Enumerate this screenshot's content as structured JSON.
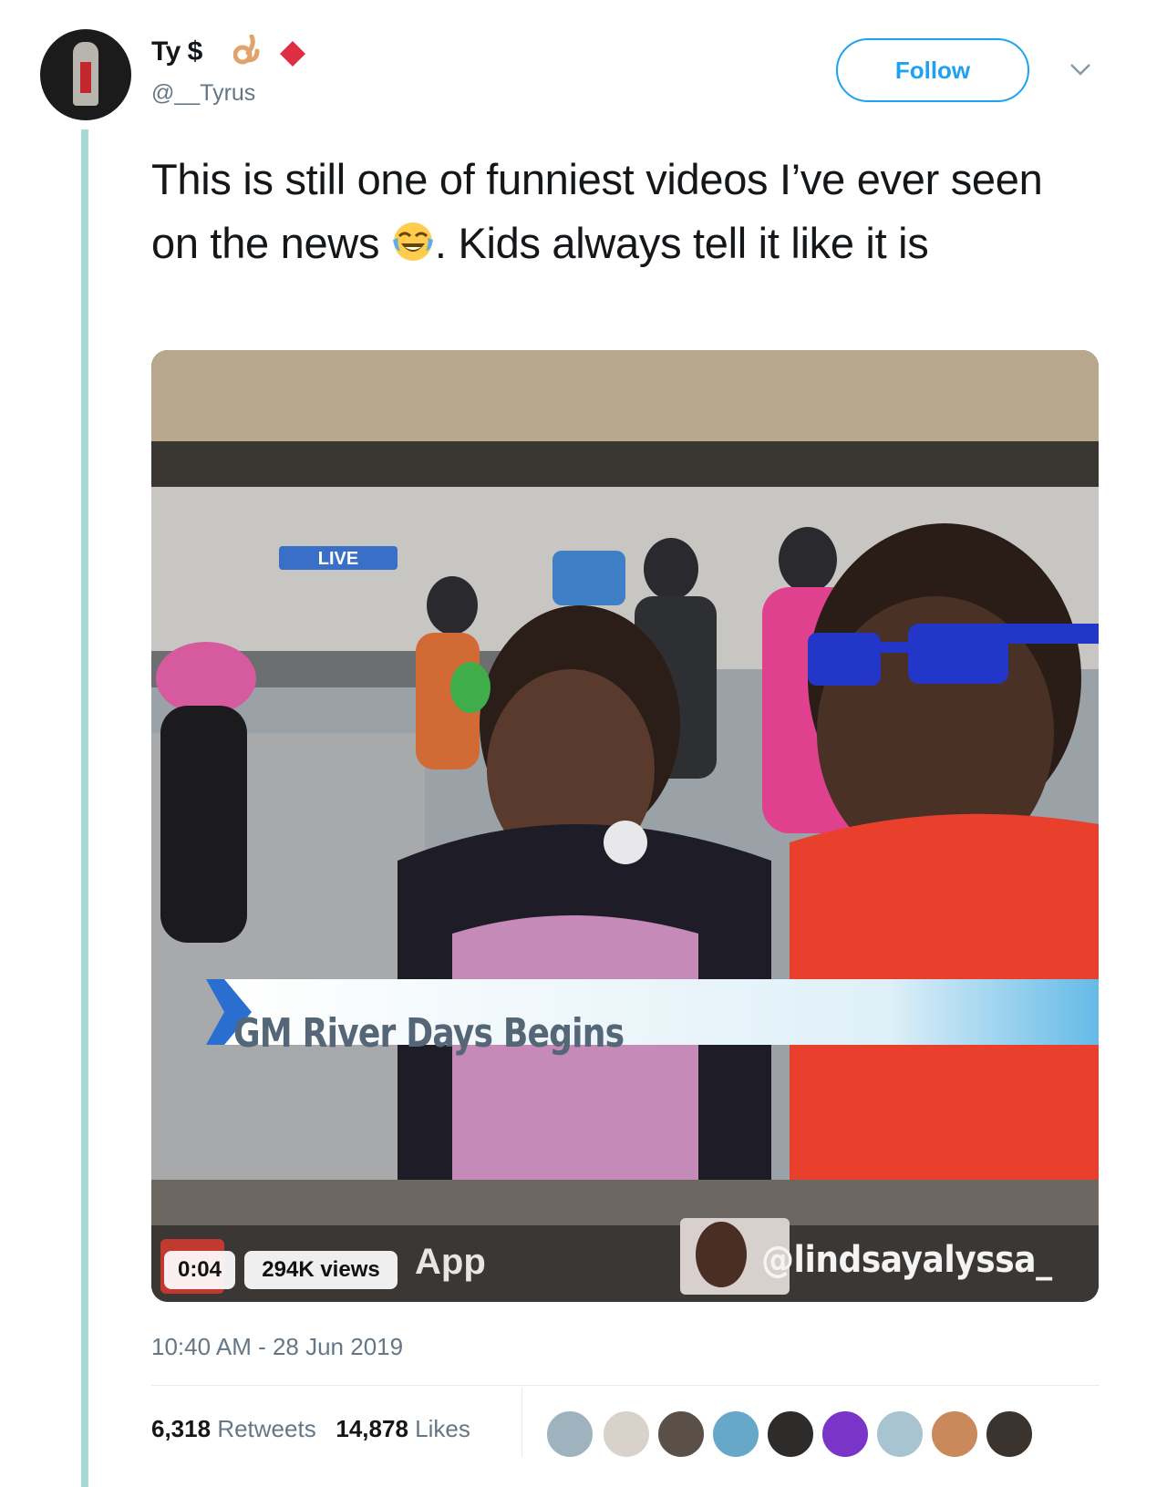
{
  "author": {
    "display_name": "Ty $",
    "handle": "@__Tyrus",
    "name_icons": [
      "ok-hand-icon",
      "red-diamond-icon"
    ]
  },
  "follow_button": {
    "label": "Follow"
  },
  "tweet": {
    "text_part1": "This is still one of funniest videos I’ve ever seen on the news ",
    "emoji": "face-with-tears-of-joy-icon",
    "text_part2": ". Kids always tell it like it is"
  },
  "video": {
    "live_badge": "LIVE",
    "lower_third": "GM River Days Begins",
    "app_text": "App",
    "watermark": "@lindsayalyssa_",
    "duration": "0:04",
    "views": "294K views"
  },
  "timestamp": "10:40 AM - 28 Jun 2019",
  "stats": {
    "retweets_count": "6,318",
    "retweets_label": "Retweets",
    "likes_count": "14,878",
    "likes_label": "Likes"
  },
  "colors": {
    "accent": "#1da1f2",
    "thread_line": "#a6d8da",
    "muted_text": "#657786"
  }
}
